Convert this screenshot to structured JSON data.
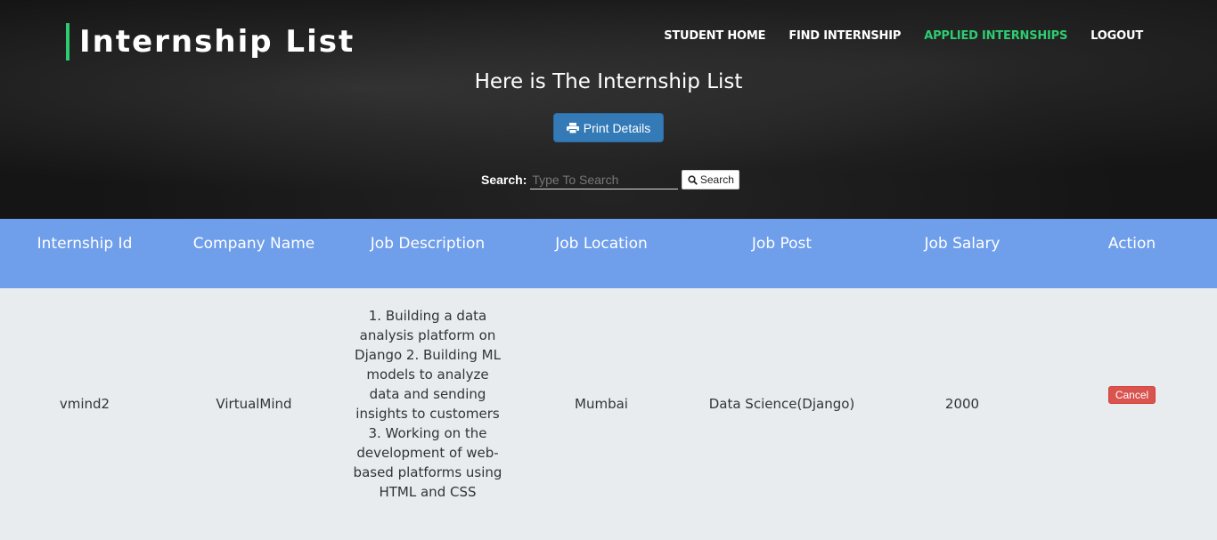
{
  "header": {
    "brand": "Internship List",
    "nav": [
      {
        "label": "STUDENT HOME",
        "active": false
      },
      {
        "label": "FIND INTERNSHIP",
        "active": false
      },
      {
        "label": "APPLIED INTERNSHIPS",
        "active": true
      },
      {
        "label": "LOGOUT",
        "active": false
      }
    ],
    "title": "Here is The Internship List",
    "print_label": "Print Details",
    "print_icon": "print-icon"
  },
  "search": {
    "label": "Search:",
    "placeholder": "Type To Search",
    "value": "",
    "button_label": "Search",
    "button_icon": "search-icon"
  },
  "table": {
    "headers": [
      "Internship Id",
      "Company Name",
      "Job Description",
      "Job Location",
      "Job Post",
      "Job Salary",
      "Action"
    ],
    "rows": [
      {
        "id": "vmind2",
        "company": "VirtualMind",
        "description": "1. Building a data analysis platform on Django 2. Building ML models to analyze data and sending insights to customers 3. Working on the development of web-based platforms using HTML and CSS",
        "location": "Mumbai",
        "post": "Data Science(Django)",
        "salary": "2000",
        "action_label": "Cancel"
      }
    ]
  },
  "colors": {
    "accent": "#2ecc71",
    "table_header": "#6f9eeb",
    "print_button": "#337ab7",
    "cancel_button": "#d9534f",
    "row_bg": "#e8ecef"
  }
}
